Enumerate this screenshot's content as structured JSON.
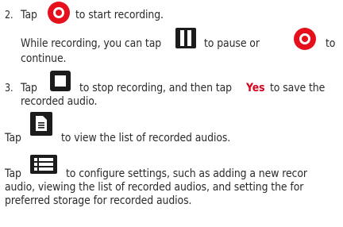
{
  "steps": [
    {
      "num": "2.",
      "pre": "Tap",
      "post": "to start recording."
    },
    {
      "sub_pre": "While recording, you can tap",
      "sub_mid": "to pause or",
      "sub_post": "to",
      "sub_cont": "continue."
    },
    {
      "num": "3.",
      "pre": "Tap",
      "post": "to stop recording, and then tap",
      "yes": "Yes",
      "post2": "to save the",
      "cont": "recorded audio."
    }
  ],
  "list_tip": {
    "pre": "Tap",
    "post": "to view the list of recorded audios."
  },
  "settings_tip": {
    "pre": "Tap",
    "line1": "to configure settings, such as adding a new recor",
    "line2": "audio, viewing the list of recorded audios, and setting the for",
    "line3": "preferred storage for recorded audios."
  },
  "icons": {
    "record": "record-icon",
    "pause": "pause-icon",
    "stop": "stop-icon",
    "list": "document-list-icon",
    "settings": "settings-menu-icon"
  },
  "colors": {
    "record_red": "#e5101b",
    "yes_red": "#d8001c",
    "icon_black": "#1c1c1c"
  }
}
